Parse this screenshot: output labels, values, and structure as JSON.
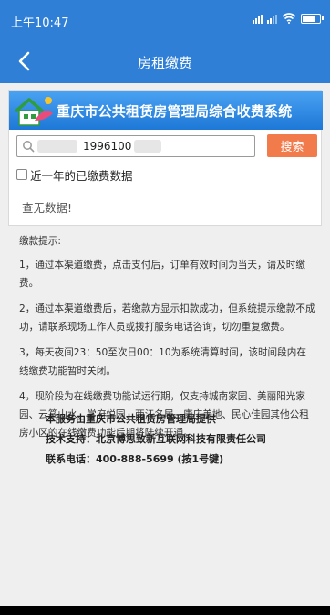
{
  "status_bar": {
    "time": "上午10:47"
  },
  "header": {
    "title": "房租缴费"
  },
  "banner": {
    "title": "重庆市公共租赁房管理局综合收费系统"
  },
  "search": {
    "value": "1996100",
    "button_label": "搜索"
  },
  "filter": {
    "label": "近一年的已缴费数据"
  },
  "results": {
    "empty_text": "查无数据!"
  },
  "notice": {
    "title": "缴款提示:",
    "items": [
      "1，通过本渠道缴费，点击支付后，订单有效时间为当天，请及时缴费。",
      "2，通过本渠道缴费后，若缴款方显示扣款成功，但系统提示缴款不成功，请联系现场工作人员或拨打服务电话咨询，切勿重复缴费。",
      "3，每天夜间23：50至次日00：10为系统清算时间，该时间段内在线缴费功能暂时关闭。",
      "4，现阶段为在线缴费功能试运行期，仅支持城南家园、美丽阳光家园、云篆山水、学府悦园、两江名居、康庄美地、民心佳园其他公租房小区的在线缴费功能后期将陆续开通。"
    ]
  },
  "info": {
    "provider": "本服务由重庆市公共租赁房管理局提供",
    "support": "技术支持：北京博思致新互联网科技有限责任公司",
    "phone": "联系电话：400-888-5699 (按1号键)"
  },
  "colors": {
    "primary": "#2f7fd7",
    "search_button": "#f27b4c",
    "background": "#efefef"
  },
  "icons": {
    "back": "chevron-left-icon",
    "search": "search-icon",
    "logo": "house-logo-icon"
  }
}
